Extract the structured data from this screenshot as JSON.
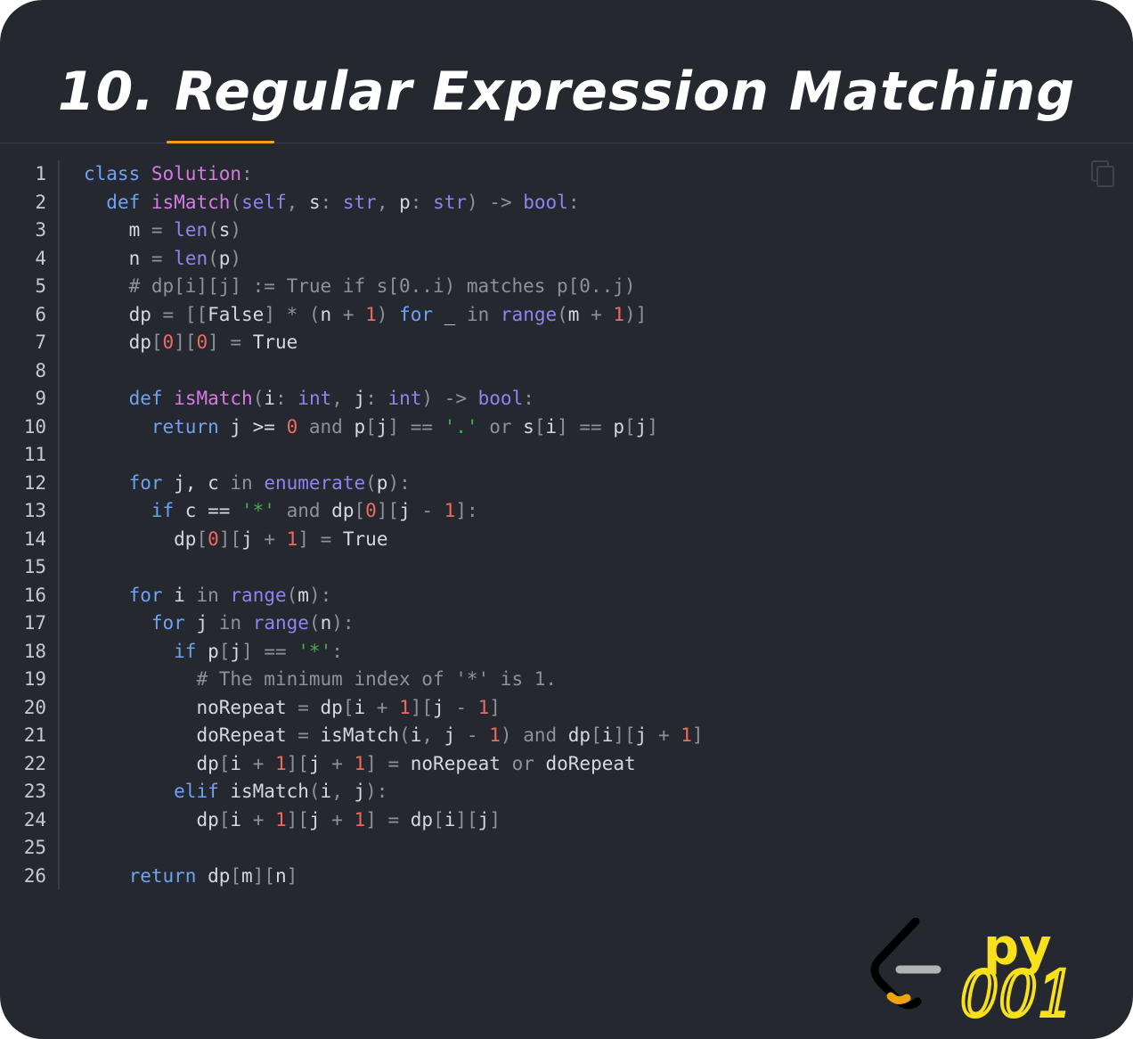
{
  "title": "10. Regular Expression Matching",
  "colors": {
    "background": "#262830",
    "accent_tab": "#f0a30a",
    "keyword": "#6ea2f5",
    "function_name": "#d57ae6",
    "builtin": "#8a86ee",
    "number": "#ec6a5e",
    "string": "#3fb04f",
    "comment": "#8e919c",
    "logo_yellow": "#f8e11a"
  },
  "icons": {
    "copy": "copy-icon",
    "logo": "leetcode-logo"
  },
  "logo_text": {
    "language": "py",
    "number": "001"
  },
  "code": {
    "lines": [
      {
        "n": "1",
        "indent": "",
        "tokens": [
          {
            "t": "class",
            "c": "kw"
          },
          {
            "t": " ",
            "c": "pl"
          },
          {
            "t": "Solution",
            "c": "fn"
          },
          {
            "t": ":",
            "c": "op"
          }
        ]
      },
      {
        "n": "2",
        "indent": "  ",
        "tokens": [
          {
            "t": "def",
            "c": "kw"
          },
          {
            "t": " ",
            "c": "pl"
          },
          {
            "t": "isMatch",
            "c": "fn"
          },
          {
            "t": "(",
            "c": "op"
          },
          {
            "t": "self",
            "c": "bi"
          },
          {
            "t": ", ",
            "c": "op"
          },
          {
            "t": "s",
            "c": "pl"
          },
          {
            "t": ": ",
            "c": "op"
          },
          {
            "t": "str",
            "c": "bi"
          },
          {
            "t": ", ",
            "c": "op"
          },
          {
            "t": "p",
            "c": "pl"
          },
          {
            "t": ": ",
            "c": "op"
          },
          {
            "t": "str",
            "c": "bi"
          },
          {
            "t": ") -> ",
            "c": "op"
          },
          {
            "t": "bool",
            "c": "bi"
          },
          {
            "t": ":",
            "c": "op"
          }
        ]
      },
      {
        "n": "3",
        "indent": "    ",
        "tokens": [
          {
            "t": "m",
            "c": "pl"
          },
          {
            "t": " = ",
            "c": "op"
          },
          {
            "t": "len",
            "c": "bi"
          },
          {
            "t": "(",
            "c": "op"
          },
          {
            "t": "s",
            "c": "pl"
          },
          {
            "t": ")",
            "c": "op"
          }
        ]
      },
      {
        "n": "4",
        "indent": "    ",
        "tokens": [
          {
            "t": "n",
            "c": "pl"
          },
          {
            "t": " = ",
            "c": "op"
          },
          {
            "t": "len",
            "c": "bi"
          },
          {
            "t": "(",
            "c": "op"
          },
          {
            "t": "p",
            "c": "pl"
          },
          {
            "t": ")",
            "c": "op"
          }
        ]
      },
      {
        "n": "5",
        "indent": "    ",
        "tokens": [
          {
            "t": "# dp[i][j] := True if s[0..i) matches p[0..j)",
            "c": "cm"
          }
        ]
      },
      {
        "n": "6",
        "indent": "    ",
        "tokens": [
          {
            "t": "dp",
            "c": "pl"
          },
          {
            "t": " = [[",
            "c": "op"
          },
          {
            "t": "False",
            "c": "pl"
          },
          {
            "t": "] * (",
            "c": "op"
          },
          {
            "t": "n",
            "c": "pl"
          },
          {
            "t": " + ",
            "c": "op"
          },
          {
            "t": "1",
            "c": "nm"
          },
          {
            "t": ") ",
            "c": "op"
          },
          {
            "t": "for",
            "c": "kw"
          },
          {
            "t": " _ ",
            "c": "pl"
          },
          {
            "t": "in",
            "c": "op"
          },
          {
            "t": " ",
            "c": "pl"
          },
          {
            "t": "range",
            "c": "bi"
          },
          {
            "t": "(",
            "c": "op"
          },
          {
            "t": "m",
            "c": "pl"
          },
          {
            "t": " + ",
            "c": "op"
          },
          {
            "t": "1",
            "c": "nm"
          },
          {
            "t": ")]",
            "c": "op"
          }
        ]
      },
      {
        "n": "7",
        "indent": "    ",
        "tokens": [
          {
            "t": "dp",
            "c": "pl"
          },
          {
            "t": "[",
            "c": "op"
          },
          {
            "t": "0",
            "c": "nm"
          },
          {
            "t": "][",
            "c": "op"
          },
          {
            "t": "0",
            "c": "nm"
          },
          {
            "t": "] = ",
            "c": "op"
          },
          {
            "t": "True",
            "c": "pl"
          }
        ]
      },
      {
        "n": "8",
        "indent": "",
        "tokens": []
      },
      {
        "n": "9",
        "indent": "    ",
        "tokens": [
          {
            "t": "def",
            "c": "kw"
          },
          {
            "t": " ",
            "c": "pl"
          },
          {
            "t": "isMatch",
            "c": "fn"
          },
          {
            "t": "(",
            "c": "op"
          },
          {
            "t": "i",
            "c": "pl"
          },
          {
            "t": ": ",
            "c": "op"
          },
          {
            "t": "int",
            "c": "bi"
          },
          {
            "t": ", ",
            "c": "op"
          },
          {
            "t": "j",
            "c": "pl"
          },
          {
            "t": ": ",
            "c": "op"
          },
          {
            "t": "int",
            "c": "bi"
          },
          {
            "t": ") -> ",
            "c": "op"
          },
          {
            "t": "bool",
            "c": "bi"
          },
          {
            "t": ":",
            "c": "op"
          }
        ]
      },
      {
        "n": "10",
        "indent": "      ",
        "tokens": [
          {
            "t": "return",
            "c": "kw"
          },
          {
            "t": " j >= ",
            "c": "pl"
          },
          {
            "t": "0",
            "c": "nm"
          },
          {
            "t": " and ",
            "c": "op"
          },
          {
            "t": "p",
            "c": "pl"
          },
          {
            "t": "[",
            "c": "op"
          },
          {
            "t": "j",
            "c": "pl"
          },
          {
            "t": "] == ",
            "c": "op"
          },
          {
            "t": "'.'",
            "c": "st"
          },
          {
            "t": " or ",
            "c": "op"
          },
          {
            "t": "s",
            "c": "pl"
          },
          {
            "t": "[",
            "c": "op"
          },
          {
            "t": "i",
            "c": "pl"
          },
          {
            "t": "] == ",
            "c": "op"
          },
          {
            "t": "p",
            "c": "pl"
          },
          {
            "t": "[",
            "c": "op"
          },
          {
            "t": "j",
            "c": "pl"
          },
          {
            "t": "]",
            "c": "op"
          }
        ]
      },
      {
        "n": "11",
        "indent": "",
        "tokens": []
      },
      {
        "n": "12",
        "indent": "    ",
        "tokens": [
          {
            "t": "for",
            "c": "kw"
          },
          {
            "t": " j, c ",
            "c": "pl"
          },
          {
            "t": "in",
            "c": "op"
          },
          {
            "t": " ",
            "c": "pl"
          },
          {
            "t": "enumerate",
            "c": "bi"
          },
          {
            "t": "(",
            "c": "op"
          },
          {
            "t": "p",
            "c": "pl"
          },
          {
            "t": "):",
            "c": "op"
          }
        ]
      },
      {
        "n": "13",
        "indent": "      ",
        "tokens": [
          {
            "t": "if",
            "c": "kw"
          },
          {
            "t": " c == ",
            "c": "pl"
          },
          {
            "t": "'*'",
            "c": "st"
          },
          {
            "t": " and ",
            "c": "op"
          },
          {
            "t": "dp",
            "c": "pl"
          },
          {
            "t": "[",
            "c": "op"
          },
          {
            "t": "0",
            "c": "nm"
          },
          {
            "t": "][",
            "c": "op"
          },
          {
            "t": "j",
            "c": "pl"
          },
          {
            "t": " - ",
            "c": "op"
          },
          {
            "t": "1",
            "c": "nm"
          },
          {
            "t": "]:",
            "c": "op"
          }
        ]
      },
      {
        "n": "14",
        "indent": "        ",
        "tokens": [
          {
            "t": "dp",
            "c": "pl"
          },
          {
            "t": "[",
            "c": "op"
          },
          {
            "t": "0",
            "c": "nm"
          },
          {
            "t": "][",
            "c": "op"
          },
          {
            "t": "j",
            "c": "pl"
          },
          {
            "t": " + ",
            "c": "op"
          },
          {
            "t": "1",
            "c": "nm"
          },
          {
            "t": "] = ",
            "c": "op"
          },
          {
            "t": "True",
            "c": "pl"
          }
        ]
      },
      {
        "n": "15",
        "indent": "",
        "tokens": []
      },
      {
        "n": "16",
        "indent": "    ",
        "tokens": [
          {
            "t": "for",
            "c": "kw"
          },
          {
            "t": " i ",
            "c": "pl"
          },
          {
            "t": "in",
            "c": "op"
          },
          {
            "t": " ",
            "c": "pl"
          },
          {
            "t": "range",
            "c": "bi"
          },
          {
            "t": "(",
            "c": "op"
          },
          {
            "t": "m",
            "c": "pl"
          },
          {
            "t": "):",
            "c": "op"
          }
        ]
      },
      {
        "n": "17",
        "indent": "      ",
        "tokens": [
          {
            "t": "for",
            "c": "kw"
          },
          {
            "t": " j ",
            "c": "pl"
          },
          {
            "t": "in",
            "c": "op"
          },
          {
            "t": " ",
            "c": "pl"
          },
          {
            "t": "range",
            "c": "bi"
          },
          {
            "t": "(",
            "c": "op"
          },
          {
            "t": "n",
            "c": "pl"
          },
          {
            "t": "):",
            "c": "op"
          }
        ]
      },
      {
        "n": "18",
        "indent": "        ",
        "tokens": [
          {
            "t": "if",
            "c": "kw"
          },
          {
            "t": " p",
            "c": "pl"
          },
          {
            "t": "[",
            "c": "op"
          },
          {
            "t": "j",
            "c": "pl"
          },
          {
            "t": "] == ",
            "c": "op"
          },
          {
            "t": "'*'",
            "c": "st"
          },
          {
            "t": ":",
            "c": "op"
          }
        ]
      },
      {
        "n": "19",
        "indent": "          ",
        "tokens": [
          {
            "t": "# The minimum index of '*' is 1.",
            "c": "cm"
          }
        ]
      },
      {
        "n": "20",
        "indent": "          ",
        "tokens": [
          {
            "t": "noRepeat",
            "c": "pl"
          },
          {
            "t": " = ",
            "c": "op"
          },
          {
            "t": "dp",
            "c": "pl"
          },
          {
            "t": "[",
            "c": "op"
          },
          {
            "t": "i",
            "c": "pl"
          },
          {
            "t": " + ",
            "c": "op"
          },
          {
            "t": "1",
            "c": "nm"
          },
          {
            "t": "][",
            "c": "op"
          },
          {
            "t": "j",
            "c": "pl"
          },
          {
            "t": " - ",
            "c": "op"
          },
          {
            "t": "1",
            "c": "nm"
          },
          {
            "t": "]",
            "c": "op"
          }
        ]
      },
      {
        "n": "21",
        "indent": "          ",
        "tokens": [
          {
            "t": "doRepeat",
            "c": "pl"
          },
          {
            "t": " = ",
            "c": "op"
          },
          {
            "t": "isMatch",
            "c": "pl"
          },
          {
            "t": "(",
            "c": "op"
          },
          {
            "t": "i",
            "c": "pl"
          },
          {
            "t": ", ",
            "c": "op"
          },
          {
            "t": "j",
            "c": "pl"
          },
          {
            "t": " - ",
            "c": "op"
          },
          {
            "t": "1",
            "c": "nm"
          },
          {
            "t": ") and ",
            "c": "op"
          },
          {
            "t": "dp",
            "c": "pl"
          },
          {
            "t": "[",
            "c": "op"
          },
          {
            "t": "i",
            "c": "pl"
          },
          {
            "t": "][",
            "c": "op"
          },
          {
            "t": "j",
            "c": "pl"
          },
          {
            "t": " + ",
            "c": "op"
          },
          {
            "t": "1",
            "c": "nm"
          },
          {
            "t": "]",
            "c": "op"
          }
        ]
      },
      {
        "n": "22",
        "indent": "          ",
        "tokens": [
          {
            "t": "dp",
            "c": "pl"
          },
          {
            "t": "[",
            "c": "op"
          },
          {
            "t": "i",
            "c": "pl"
          },
          {
            "t": " + ",
            "c": "op"
          },
          {
            "t": "1",
            "c": "nm"
          },
          {
            "t": "][",
            "c": "op"
          },
          {
            "t": "j",
            "c": "pl"
          },
          {
            "t": " + ",
            "c": "op"
          },
          {
            "t": "1",
            "c": "nm"
          },
          {
            "t": "] = ",
            "c": "op"
          },
          {
            "t": "noRepeat",
            "c": "pl"
          },
          {
            "t": " or ",
            "c": "op"
          },
          {
            "t": "doRepeat",
            "c": "pl"
          }
        ]
      },
      {
        "n": "23",
        "indent": "        ",
        "tokens": [
          {
            "t": "elif",
            "c": "kw"
          },
          {
            "t": " isMatch",
            "c": "pl"
          },
          {
            "t": "(",
            "c": "op"
          },
          {
            "t": "i",
            "c": "pl"
          },
          {
            "t": ", ",
            "c": "op"
          },
          {
            "t": "j",
            "c": "pl"
          },
          {
            "t": "):",
            "c": "op"
          }
        ]
      },
      {
        "n": "24",
        "indent": "          ",
        "tokens": [
          {
            "t": "dp",
            "c": "pl"
          },
          {
            "t": "[",
            "c": "op"
          },
          {
            "t": "i",
            "c": "pl"
          },
          {
            "t": " + ",
            "c": "op"
          },
          {
            "t": "1",
            "c": "nm"
          },
          {
            "t": "][",
            "c": "op"
          },
          {
            "t": "j",
            "c": "pl"
          },
          {
            "t": " + ",
            "c": "op"
          },
          {
            "t": "1",
            "c": "nm"
          },
          {
            "t": "] = ",
            "c": "op"
          },
          {
            "t": "dp",
            "c": "pl"
          },
          {
            "t": "[",
            "c": "op"
          },
          {
            "t": "i",
            "c": "pl"
          },
          {
            "t": "][",
            "c": "op"
          },
          {
            "t": "j",
            "c": "pl"
          },
          {
            "t": "]",
            "c": "op"
          }
        ]
      },
      {
        "n": "25",
        "indent": "",
        "tokens": []
      },
      {
        "n": "26",
        "indent": "    ",
        "tokens": [
          {
            "t": "return",
            "c": "kw"
          },
          {
            "t": " dp",
            "c": "pl"
          },
          {
            "t": "[",
            "c": "op"
          },
          {
            "t": "m",
            "c": "pl"
          },
          {
            "t": "][",
            "c": "op"
          },
          {
            "t": "n",
            "c": "pl"
          },
          {
            "t": "]",
            "c": "op"
          }
        ]
      }
    ]
  }
}
